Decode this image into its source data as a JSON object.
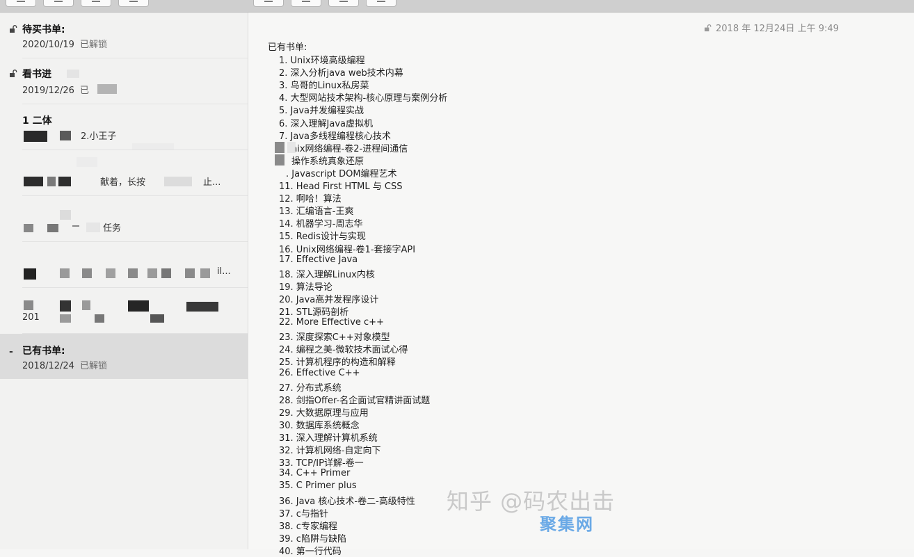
{
  "sidebar": {
    "notes": [
      {
        "title": "待买书单:",
        "date": "2020/10/19",
        "status": "已解锁",
        "icon": "unlocked-icon"
      },
      {
        "title": "看书进",
        "date": "2019/12/26",
        "status": "已",
        "icon": "unlocked-icon"
      },
      {
        "title": "1 二体",
        "date": "",
        "status": "2.小王子",
        "icon": ""
      },
      {
        "title": "",
        "date": "",
        "status": "献着，长按",
        "extra": "止...",
        "icon": ""
      },
      {
        "title": "",
        "date": "",
        "status": "任务",
        "icon": ""
      },
      {
        "title": "",
        "date": "",
        "status": "il...",
        "icon": ""
      },
      {
        "title": "",
        "date": "201",
        "status": "",
        "icon": ""
      },
      {
        "title": "已有书单:",
        "date": "2018/12/24",
        "status": "已解锁",
        "icon": "dash-icon",
        "selected": true
      }
    ]
  },
  "editor": {
    "date": "2018 年 12月24日 上午 9:49",
    "heading": "已有书单:",
    "books": [
      "1. Unix环境高级编程",
      "2. 深入分析java web技术内幕",
      "3. 鸟哥的Linux私房菜",
      "4. 大型网站技术架构-核心原理与案例分析",
      "5. Java并发编程实战",
      "6. 深入理解Java虚拟机",
      "7. Java多线程编程核心技术",
      "nix网络编程-卷2-进程间通信",
      "操作系统真象还原",
      ". Javascript DOM编程艺术",
      "11. Head First HTML 与 CSS",
      "12. 啊哈！算法",
      "13. 汇编语言-王爽",
      "14. 机器学习-周志华",
      "15. Redis设计与实现",
      "16. Unix网络编程-卷1-套接字API",
      "17. Effective Java",
      "18. 深入理解Linux内核",
      "19. 算法导论",
      "20. Java高并发程序设计",
      "21. STL源码剖析",
      "22. More Effective c++",
      "23. 深度探索C++对象模型",
      "24. 编程之美-微软技术面试心得",
      "25. 计算机程序的构造和解释",
      "26. Effective C++",
      "27. 分布式系统",
      "28. 剑指Offer-名企面试官精讲面试题",
      "29. 大数据原理与应用",
      "30. 数据库系统概念",
      "31. 深入理解计算机系统",
      "32. 计算机网络-自定向下",
      "33. TCP/IP详解-卷一",
      "34. C++ Primer",
      "35. C Primer plus",
      "36. Java 核心技术-卷二-高级特性",
      "37. c与指针",
      "38. c专家编程",
      "39. c陷阱与缺陷",
      "40. 第一行代码"
    ]
  },
  "watermark": {
    "text": "知乎 @码农出击",
    "site": "聚集网"
  }
}
